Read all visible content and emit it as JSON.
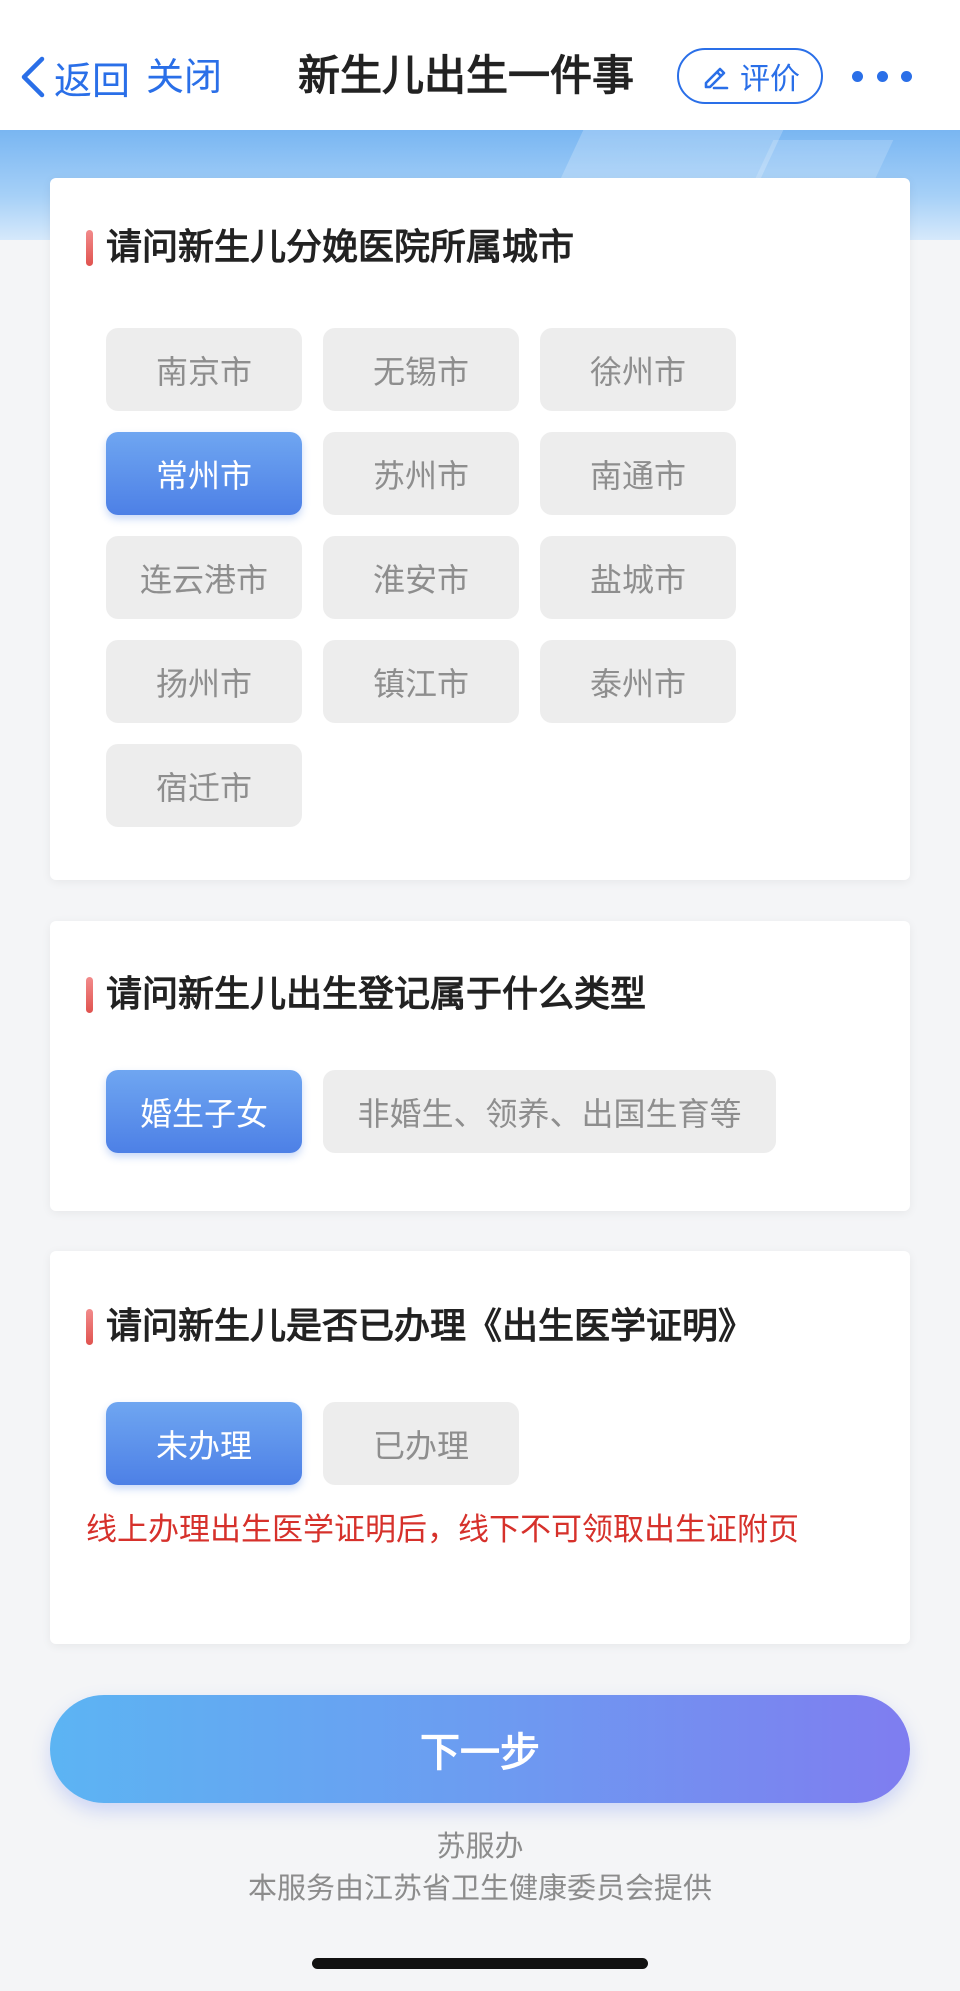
{
  "nav": {
    "back_label": "返回",
    "close_label": "关闭",
    "title": "新生儿出生一件事",
    "rate_label": "评价"
  },
  "colors": {
    "accent": "#2a6fe8",
    "selected_option": "#5a8de9",
    "option_bg": "#ededed",
    "warning": "#d6312b"
  },
  "questions": [
    {
      "title": "请问新生儿分娩医院所属城市",
      "options": [
        {
          "label": "南京市",
          "selected": false
        },
        {
          "label": "无锡市",
          "selected": false
        },
        {
          "label": "徐州市",
          "selected": false
        },
        {
          "label": "常州市",
          "selected": true
        },
        {
          "label": "苏州市",
          "selected": false
        },
        {
          "label": "南通市",
          "selected": false
        },
        {
          "label": "连云港市",
          "selected": false
        },
        {
          "label": "淮安市",
          "selected": false
        },
        {
          "label": "盐城市",
          "selected": false
        },
        {
          "label": "扬州市",
          "selected": false
        },
        {
          "label": "镇江市",
          "selected": false
        },
        {
          "label": "泰州市",
          "selected": false
        },
        {
          "label": "宿迁市",
          "selected": false
        }
      ]
    },
    {
      "title": "请问新生儿出生登记属于什么类型",
      "options": [
        {
          "label": "婚生子女",
          "selected": true
        },
        {
          "label": "非婚生、领养、出国生育等",
          "selected": false
        }
      ]
    },
    {
      "title": "请问新生儿是否已办理《出生医学证明》",
      "options": [
        {
          "label": "未办理",
          "selected": true
        },
        {
          "label": "已办理",
          "selected": false
        }
      ],
      "warning": "线上办理出生医学证明后，线下不可领取出生证附页"
    }
  ],
  "next_button_label": "下一步",
  "footer": {
    "provider_name": "苏服办",
    "provider_note": "本服务由江苏省卫生健康委员会提供"
  }
}
